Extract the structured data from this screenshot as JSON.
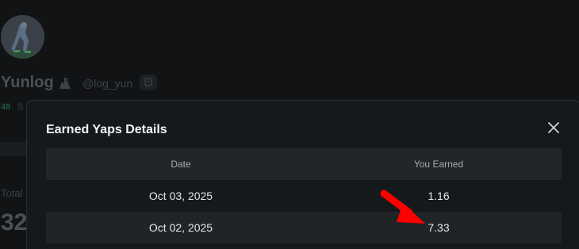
{
  "profile": {
    "name": "Yunlog",
    "handle": "@log_yun",
    "stat_value": "48",
    "stat_label": "S",
    "total_label": "Total",
    "total_value": "32",
    "avatar_icon": "avatar-image",
    "name_badge_icon": "flag-badge-icon",
    "copy_icon": "copy-icon"
  },
  "modal": {
    "title": "Earned Yaps Details",
    "close_icon": "close-icon",
    "columns": [
      "Date",
      "You Earned"
    ],
    "rows": [
      {
        "date": "Oct 03, 2025",
        "earned": "1.16"
      },
      {
        "date": "Oct 02, 2025",
        "earned": "7.33"
      }
    ]
  },
  "annotation": {
    "arrow_color": "#ff0000"
  },
  "colors": {
    "background": "#111315",
    "modal": "#16191c",
    "header_row": "#22262a",
    "alt_row": "#202427",
    "accent_green": "#1f5c3e"
  }
}
